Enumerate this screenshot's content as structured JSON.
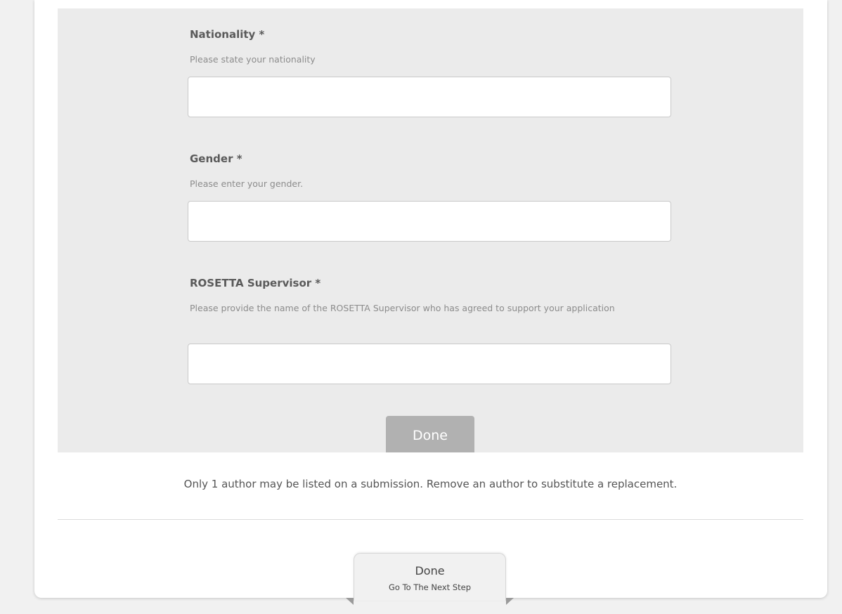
{
  "form": {
    "fields": [
      {
        "label": "Nationality *",
        "help": "Please state your nationality",
        "value": "",
        "placeholder": ""
      },
      {
        "label": "Gender *",
        "help": "Please enter your gender.",
        "value": "",
        "placeholder": ""
      },
      {
        "label": "ROSETTA Supervisor *",
        "help": "Please provide the name of the ROSETTA Supervisor who has agreed to support your application",
        "value": "",
        "placeholder": ""
      }
    ],
    "done_label": "Done"
  },
  "author_note": "Only 1 author may be listed on a submission. Remove an author to substitute a replacement.",
  "next_step": {
    "title": "Done",
    "subtitle": "Go To The Next Step"
  },
  "colors": {
    "page_bg": "#f1f1f1",
    "panel_bg": "#ebebeb",
    "done_button": "#b1b1b1"
  }
}
